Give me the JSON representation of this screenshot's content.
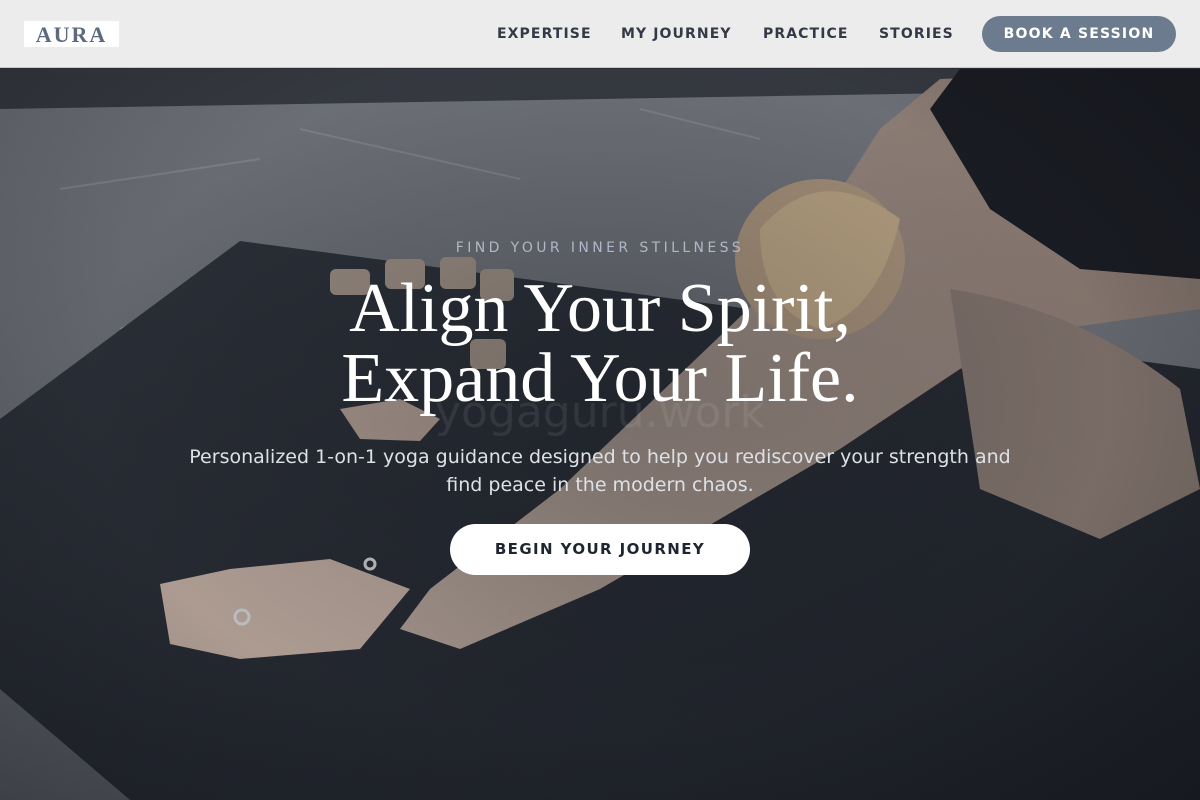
{
  "header": {
    "logo": "AURA",
    "nav": [
      {
        "label": "EXPERTISE"
      },
      {
        "label": "MY JOURNEY"
      },
      {
        "label": "PRACTICE"
      },
      {
        "label": "STORIES"
      }
    ],
    "cta_label": "BOOK A SESSION"
  },
  "hero": {
    "eyebrow": "FIND YOUR INNER STILLNESS",
    "title_line1": "Align Your Spirit,",
    "title_line2": "Expand Your Life.",
    "subtitle": "Personalized 1-on-1 yoga guidance designed to help you rediscover your strength and find peace in the modern chaos.",
    "button_label": "BEGIN YOUR JOURNEY",
    "watermark": "yogaguru.work"
  },
  "colors": {
    "header_bg": "#ececec",
    "accent": "#6d7b8e",
    "nav_text": "#333a45",
    "hero_button_bg": "#ffffff"
  }
}
